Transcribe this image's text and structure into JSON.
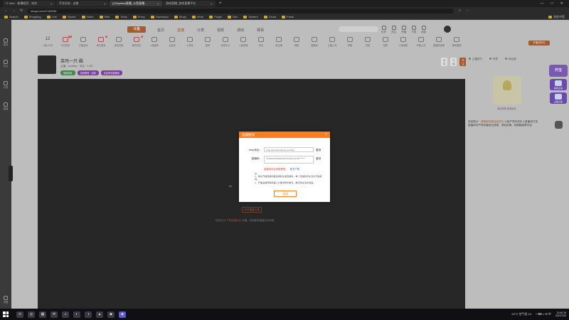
{
  "browser": {
    "tabs": [
      {
        "label": "IT·ribre · 新爆相页 · 浏览",
        "active": false
      },
      {
        "label": "手艺机关 · 出售",
        "active": false
      },
      {
        "label": "(1)%yelbol直播_斗鱼直播…",
        "active": true
      },
      {
        "label": "游戏直播_游戏直播平台",
        "active": false
      }
    ],
    "new_tab": "+",
    "url": "douyu.com/7140234",
    "bookmarks": [
      "Search",
      "Shopping",
      "Live",
      "Sports",
      "Video",
      "Wiki",
      "Tools",
      "Proxy",
      "Download",
      "Study",
      "Work",
      "Plugin",
      "Dev",
      "System",
      "Cloud",
      "Email"
    ],
    "bookmarks_right": "其他书签",
    "window_controls": [
      "—",
      "□",
      "✕"
    ]
  },
  "sidebar": {
    "items": [
      "推荐",
      "关注",
      "分类",
      "直播"
    ],
    "bottom": "设置"
  },
  "site": {
    "logo": "斗鱼",
    "nav": [
      {
        "label": "首页",
        "hl": false
      },
      {
        "label": "直播",
        "hl": true
      },
      {
        "label": "分类",
        "hl": false
      },
      {
        "label": "视频",
        "hl": false
      },
      {
        "label": "游戏",
        "hl": false
      },
      {
        "label": "赛事",
        "hl": false
      }
    ],
    "user_icons": [
      "历史",
      "关注",
      "开播",
      "下载",
      "消息"
    ],
    "categories": [
      {
        "label": "斗鱼1小时",
        "num": "12",
        "first": true
      },
      {
        "label": "今日任务",
        "badge": "17"
      },
      {
        "label": "主播活动"
      },
      {
        "label": "每日签到",
        "badge": "4"
      },
      {
        "label": "游戏充值"
      },
      {
        "label": "我的背包",
        "badge": "2"
      },
      {
        "label": "斗鱼超市"
      },
      {
        "label": "云游戏"
      },
      {
        "label": "小游戏"
      },
      {
        "label": "鱼吧"
      },
      {
        "label": "赛事中心"
      },
      {
        "label": "斗鱼商城"
      },
      {
        "label": "车队"
      },
      {
        "label": "粉丝牌"
      },
      {
        "label": "视频"
      },
      {
        "label": "直播间"
      },
      {
        "label": "主播工具"
      },
      {
        "label": "房管"
      },
      {
        "label": "贵族"
      },
      {
        "label": "钻粉"
      },
      {
        "label": "斗鱼课堂"
      },
      {
        "label": "开播工具"
      },
      {
        "label": "直播间设置"
      },
      {
        "label": "房间管理"
      }
    ],
    "open_button": "开播领好礼"
  },
  "streamer": {
    "name": "菜鸡一只·酷",
    "meta": "主播：vvvlulipo · 关注 · 1.4万",
    "tags": [
      {
        "label": "网游竞技",
        "color": "g"
      },
      {
        "label": "英雄联盟 · 召唤",
        "color": "p"
      },
      {
        "label": "欢迎来到直播间",
        "color": "p"
      }
    ],
    "right_buttons": [
      "分享",
      "订阅",
      "关注"
    ]
  },
  "video": {
    "glyph": "⌁",
    "open_btn": "打开直播工具",
    "hint_pre": "您还可以 ",
    "hint_link": "下载直播伴侣",
    "hint_post": " 开播，实现更多直播互动功能"
  },
  "right_panel": {
    "tabs": [
      "主播排行",
      "贵宾",
      "粉丝团"
    ],
    "rank_caption": "暂无贵宾 快来抢位",
    "chat_line1": "系统提示：",
    "chat_line1_hl": "弹幕服务器连接成功",
    "chat_line1_post": " 斗鱼严禁未成年人直播或打赏",
    "chat_line2": "直播间内严禁传播违法违规、低俗色情、吸烟酗酒等内容"
  },
  "far_right": {
    "top": "开宝",
    "items": [
      "超级主播",
      "主播之星"
    ]
  },
  "modal": {
    "title": "直播推流",
    "close": "×",
    "rtmp_label": "rtmp地址：",
    "rtmp_value": "rtmp://sendtc3.douyu.com/live",
    "key_label": "直播码：",
    "key_value": "7140234rxHAW4xdx?wsSecret=4b*******",
    "copy": "复制",
    "link_red": "直播流地址获取教程",
    "link_blue": "推流下载",
    "notes": [
      "注：",
      "1、每次开播直播码都会重新生成直播码，每个直播码仅在当次开播有效。",
      "2、开播后推荐使用第三方推流软件推流，推流地址请勿泄露。"
    ],
    "close_button": "关闭"
  },
  "taskbar": {
    "apps": [
      "⊙",
      "◎",
      "▦",
      "✉",
      "♫",
      "◐",
      "◑",
      "▲",
      "◆",
      "◉"
    ],
    "weather": "22°C 空气优 14",
    "tray_icons": "^ ⌨ ◗ ✉ 中",
    "time": "20:40:15",
    "date": "2021/7/20"
  }
}
